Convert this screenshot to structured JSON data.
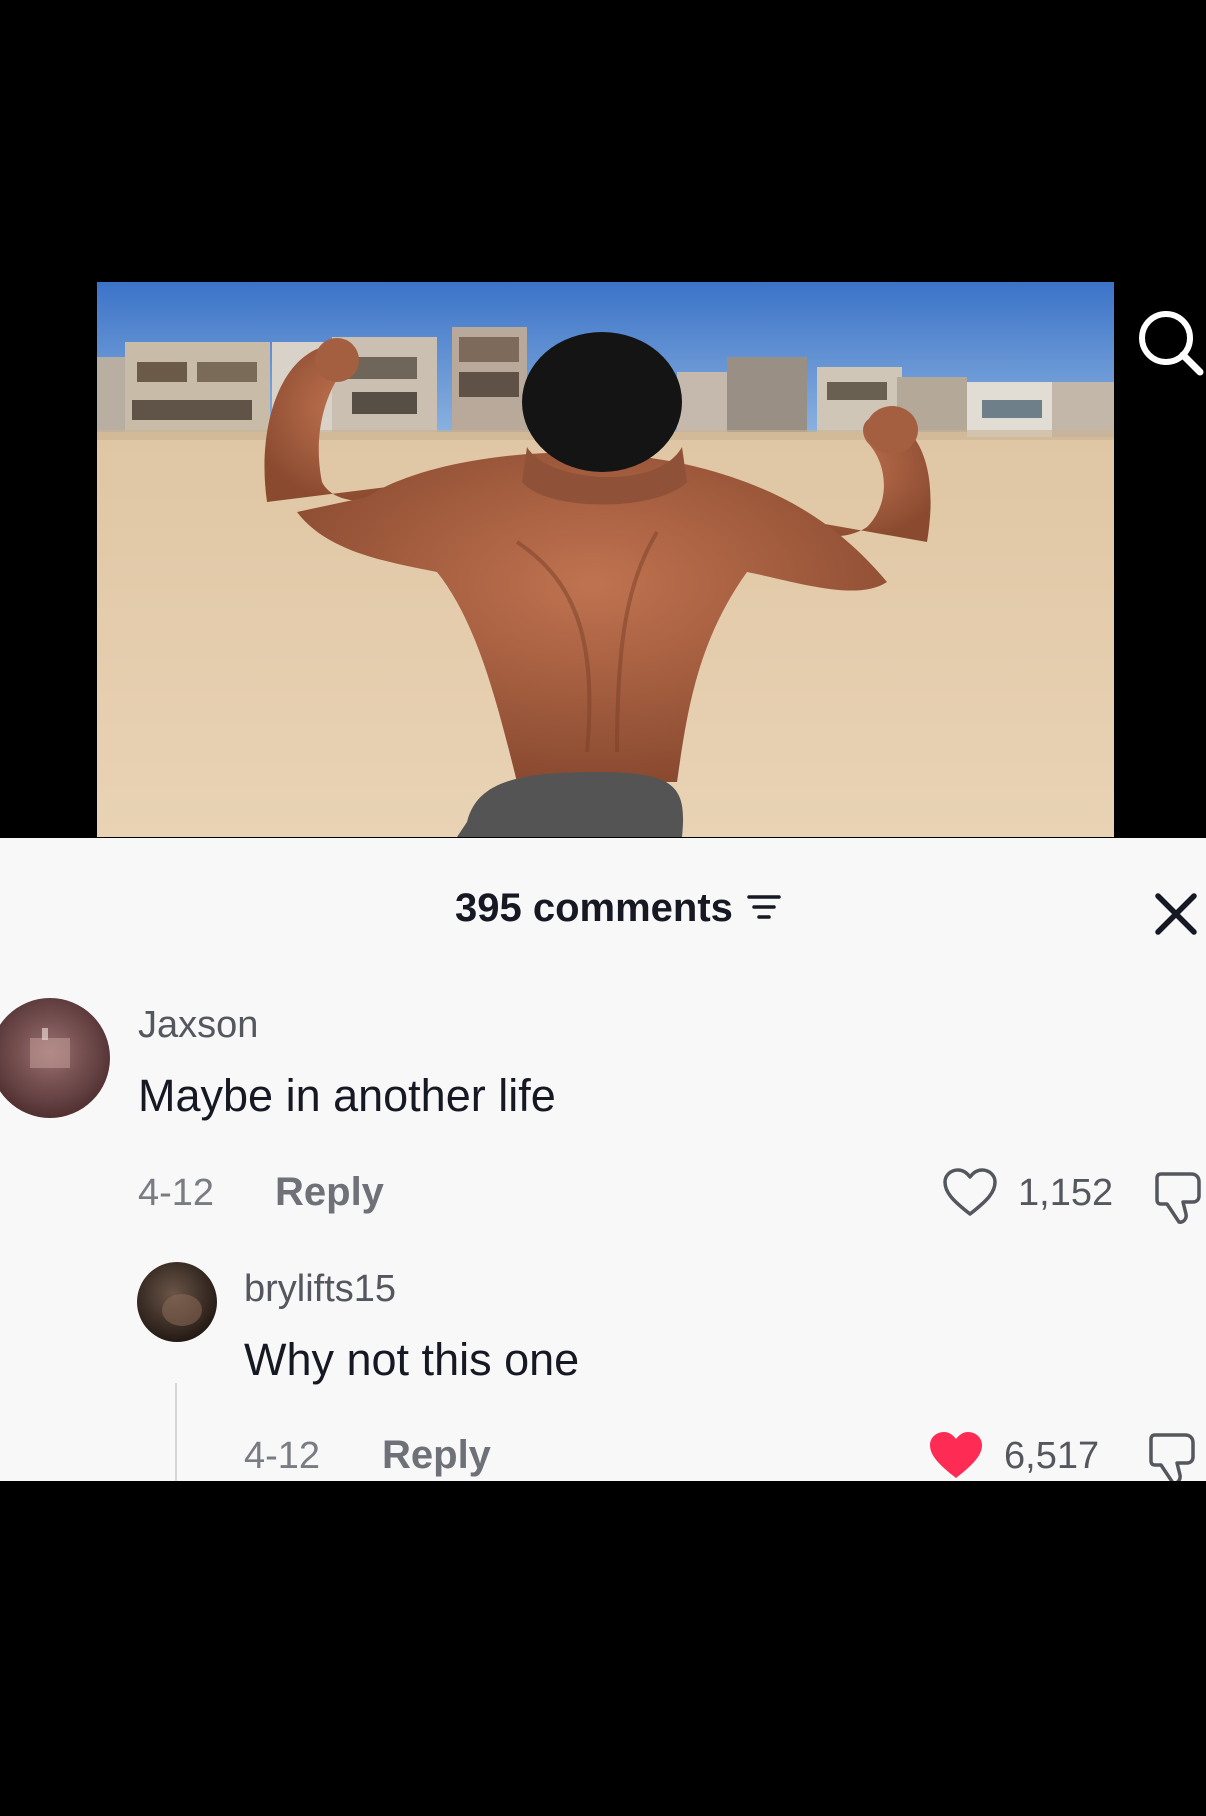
{
  "sheet": {
    "comments_count": "395 comments"
  },
  "comments": [
    {
      "username": "Jaxson",
      "text": "Maybe in another life",
      "date": "4-12",
      "reply_label": "Reply",
      "likes": "1,152",
      "liked": false
    },
    {
      "username": "brylifts15",
      "text": "Why not this one",
      "date": "4-12",
      "reply_label": "Reply",
      "likes": "6,517",
      "liked": true
    }
  ],
  "icons": {
    "search": "search-icon",
    "filter": "filter-icon",
    "close": "close-icon",
    "like": "heart-icon",
    "dislike": "thumbs-down-icon"
  },
  "colors": {
    "liked_heart": "#fe2c55",
    "sheet_bg": "#f8f8f8",
    "text_primary": "#161823"
  }
}
